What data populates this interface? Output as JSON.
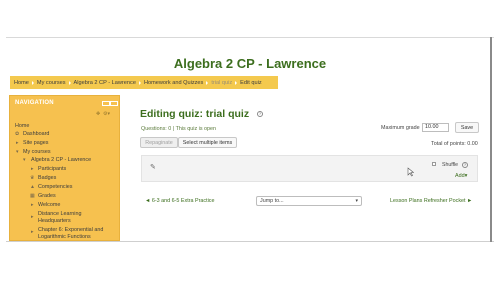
{
  "site": {
    "title": "Algebra 2 CP - Lawrence"
  },
  "breadcrumb": [
    {
      "label": "Home",
      "dim": false
    },
    {
      "label": "My courses",
      "dim": false
    },
    {
      "label": "Algebra 2 CP - Lawrence",
      "dim": false
    },
    {
      "label": "Homework and Quizzes",
      "dim": false
    },
    {
      "label": "trial quiz",
      "dim": true
    },
    {
      "label": "Edit quiz",
      "dim": false
    }
  ],
  "navigation": {
    "header": "NAVIGATION",
    "items": {
      "home": "Home",
      "dashboard": "Dashboard",
      "site_pages": "Site pages",
      "my_courses": "My courses",
      "course": "Algebra 2 CP - Lawrence",
      "participants": "Participants",
      "badges": "Badges",
      "competencies": "Competencies",
      "grades": "Grades",
      "welcome": "Welcome",
      "distance_learning_1": "Distance Learning",
      "distance_learning_2": "Headquarters",
      "chapter6_1": "Chapter 6: Exponential and",
      "chapter6_2": "Logarithmic Functions"
    },
    "glyphs": {
      "dashboard": "✿",
      "site_pages": "▸",
      "my_courses": "▾",
      "course": "▾",
      "participants": "▸",
      "badges": "♛",
      "competencies": "▲",
      "grades": "▦",
      "welcome": "▸",
      "distance_learning": "▸",
      "chapter6": "▸"
    }
  },
  "main": {
    "title": "Editing quiz: trial quiz",
    "help_glyph": "?",
    "status": "Questions: 0 | This quiz is open",
    "repaginate_label": "Repaginate",
    "select_multiple_label": "Select multiple items",
    "max_grade_label": "Maximum grade",
    "max_grade_value": "10.00",
    "save_label": "Save",
    "total_points": "Total of points: 0.00",
    "shuffle_label": "Shuffle",
    "add_label": "Add",
    "add_caret": "▾",
    "prev_activity": "◄ 6-3 and 6-5 Extra Practice",
    "jump_to": "Jump to...",
    "jump_caret": "▾",
    "next_activity": "Lesson Plans Refresher Pocket ►"
  },
  "colors": {
    "accent_yellow": "#f4c94e",
    "title_green": "#3c6e1e"
  }
}
